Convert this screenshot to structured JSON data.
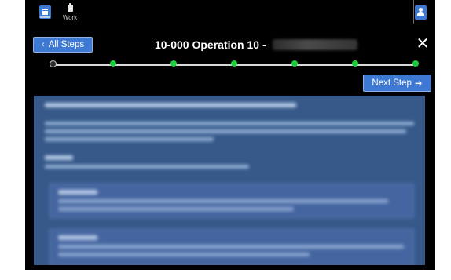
{
  "topbar": {
    "menu_icon": "menu-icon",
    "work_label": "Work",
    "work_icon": "clipboard-icon",
    "user_icon": "user-icon"
  },
  "header": {
    "all_steps_label": "All Steps",
    "title": "10-000 Operation 10 -",
    "close_icon": "close-icon"
  },
  "progress": {
    "total_steps": 7,
    "current_step": 1,
    "completed_color": "#1ccf3c",
    "track_color": "#d8d8d8"
  },
  "navigation": {
    "next_step_label": "Next Step"
  },
  "colors": {
    "accent": "#3d79d2",
    "background": "#000000",
    "content_panel": "#36598a"
  }
}
